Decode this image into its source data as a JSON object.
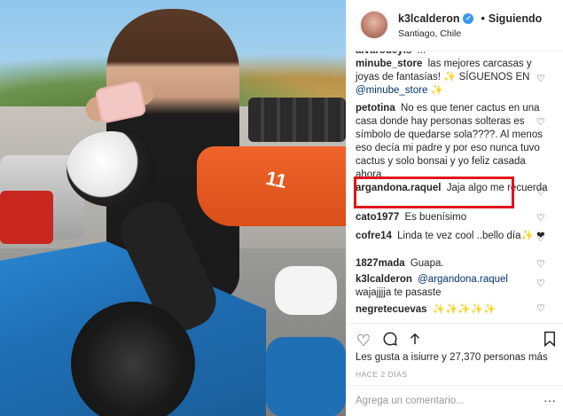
{
  "post": {
    "username": "k3lcalderon",
    "verified": true,
    "separator": "•",
    "follow_label": "Siguiendo",
    "location": "Santiago, Chile",
    "kart_number": "11"
  },
  "comments": [
    {
      "user": "alvarodeyis",
      "text": "..."
    },
    {
      "user": "minube_store",
      "text": "las mejores carcasas y joyas de fantasías! ✨ SÍGUENOS EN",
      "mention": "@minube_store",
      "tail": "✨"
    },
    {
      "user": "petotina",
      "text": "No es que tener cactus en una casa donde hay personas solteras es símbolo de quedarse sola????. Al menos eso decía mi padre y por eso nunca tuvo cactus y solo bonsai y yo feliz casada ahora."
    },
    {
      "user": "argandona.raquel",
      "text": "Jaja algo me recuerda"
    },
    {
      "user": "cato1977",
      "text": "Es buenísimo"
    },
    {
      "user": "cofre14",
      "text": "Linda te vez cool ..bello día✨ ❤"
    },
    {
      "user": "1827mada",
      "text": "Guapa."
    },
    {
      "user": "k3lcalderon",
      "mention": "@argandona.raquel",
      "text": "wajajjjja te pasaste"
    },
    {
      "user": "negretecuevas",
      "text": "✨✨✨✨✨"
    },
    {
      "user": "",
      "text": ""
    }
  ],
  "footer": {
    "likes_text": "Les gusta a isiurre y 27,370 personas más",
    "time_text": "HACE 2 DÍAS",
    "add_comment_placeholder": "Agrega un comentario...",
    "more_symbol": "···"
  },
  "icons": {
    "like": "heart-icon",
    "comment": "comment-icon",
    "share": "share-icon",
    "save": "bookmark-icon"
  },
  "colors": {
    "highlight": "#e2141c",
    "verified": "#3897f0",
    "mention": "#003569"
  }
}
